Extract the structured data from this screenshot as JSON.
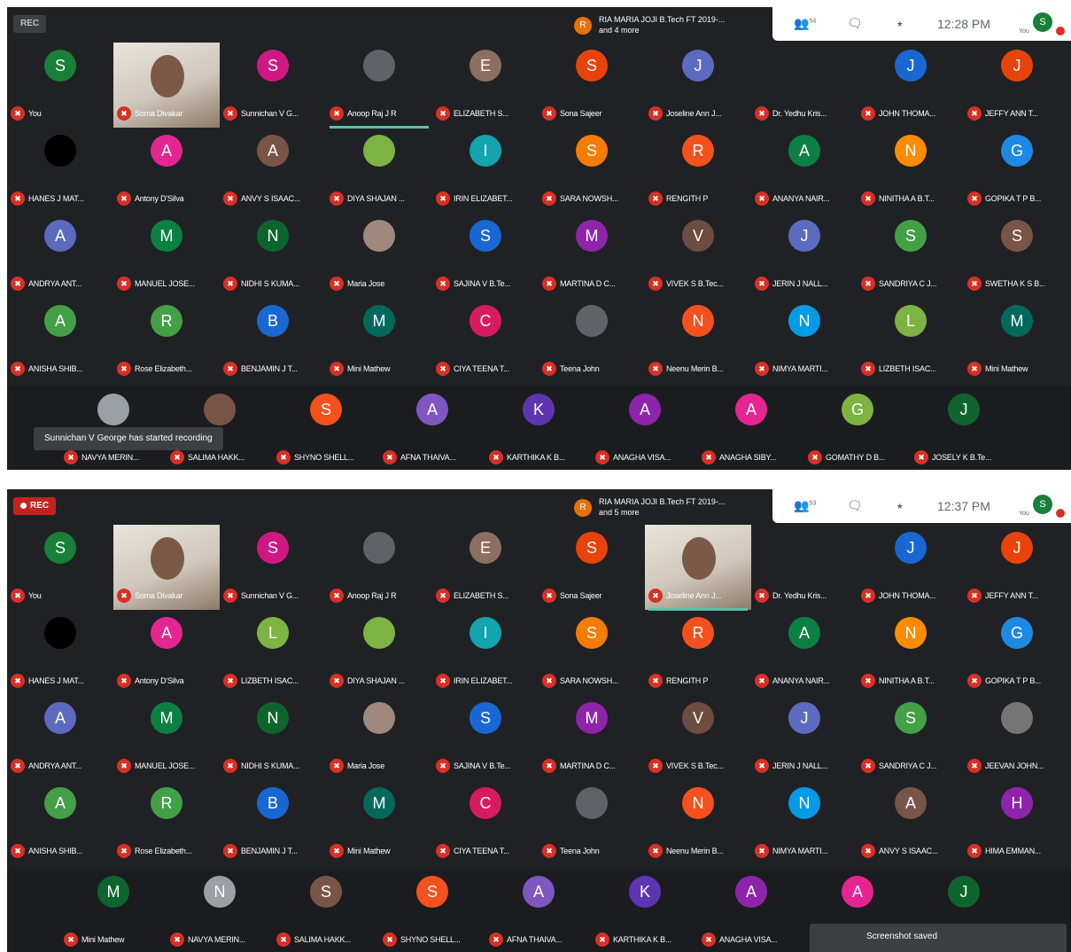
{
  "panels": [
    {
      "rec_label": "REC",
      "recording": false,
      "presenter": {
        "initial": "R",
        "name": "RIA MARIA JOJI B.Tech FT 2019-...",
        "more": "and 4 more"
      },
      "people_count": "54",
      "time": "12:28 PM",
      "self_initial": "S",
      "self_label": "You",
      "toast": "Sunnichan V George has started recording",
      "grid": [
        [
          {
            "initial": "S",
            "name": "You",
            "color": "#188038"
          },
          {
            "name": "Soma Divakar",
            "video": true
          },
          {
            "initial": "S",
            "name": "Sunnichan V G...",
            "color": "#d01884"
          },
          {
            "initial": "",
            "name": "Anoop Raj J R",
            "color": "#5f6368",
            "speaking": true
          },
          {
            "initial": "E",
            "name": "ELIZABETH S...",
            "color": "#8d6e63"
          },
          {
            "initial": "S",
            "name": "Sona Sajeer",
            "color": "#e8430a"
          },
          {
            "initial": "J",
            "name": "Joseline Ann J...",
            "color": "#5c6bc0"
          },
          {
            "initial": "",
            "name": "Dr. Yedhu Kris...",
            "color": "#202124"
          },
          {
            "initial": "J",
            "name": "JOHN THOMA...",
            "color": "#1967d2"
          },
          {
            "initial": "J",
            "name": "JEFFY ANN T...",
            "color": "#e8430a"
          }
        ],
        [
          {
            "initial": "",
            "name": "HANES J MAT...",
            "color": "#000000"
          },
          {
            "initial": "A",
            "name": "Antony D'Silva",
            "color": "#e52592"
          },
          {
            "initial": "A",
            "name": "ANVY S ISAAC...",
            "color": "#795548"
          },
          {
            "initial": "",
            "name": "DIYA SHAJAN ...",
            "color": "#7cb342"
          },
          {
            "initial": "I",
            "name": "IRIN ELIZABET...",
            "color": "#12a4af"
          },
          {
            "initial": "S",
            "name": "SARA NOWSH...",
            "color": "#f57c00"
          },
          {
            "initial": "R",
            "name": "RENGITH P",
            "color": "#f4511e"
          },
          {
            "initial": "A",
            "name": "ANANYA NAIR...",
            "color": "#0b8043"
          },
          {
            "initial": "N",
            "name": "NINITHA A B.T...",
            "color": "#fb8c00"
          },
          {
            "initial": "G",
            "name": "GOPIKA T P B...",
            "color": "#1e88e5"
          }
        ],
        [
          {
            "initial": "A",
            "name": "ANDRYA ANT...",
            "color": "#5c6bc0"
          },
          {
            "initial": "M",
            "name": "MANUEL JOSE...",
            "color": "#0b8043"
          },
          {
            "initial": "N",
            "name": "NIDHI S KUMA...",
            "color": "#0d652d"
          },
          {
            "initial": "",
            "name": "Maria Jose",
            "color": "#a1887f"
          },
          {
            "initial": "S",
            "name": "SAJINA V B.Te...",
            "color": "#1967d2"
          },
          {
            "initial": "M",
            "name": "MARTINA D C...",
            "color": "#8e24aa"
          },
          {
            "initial": "V",
            "name": "VIVEK S B.Tec...",
            "color": "#6d4c41"
          },
          {
            "initial": "J",
            "name": "JERIN J NALL...",
            "color": "#5c6bc0"
          },
          {
            "initial": "S",
            "name": "SANDRIYA C J...",
            "color": "#43a047"
          },
          {
            "initial": "S",
            "name": "SWETHA K S B...",
            "color": "#795548"
          }
        ],
        [
          {
            "initial": "A",
            "name": "ANISHA SHIB...",
            "color": "#43a047"
          },
          {
            "initial": "R",
            "name": "Rose Elizabeth...",
            "color": "#43a047"
          },
          {
            "initial": "B",
            "name": "BENJAMIN J T...",
            "color": "#1967d2"
          },
          {
            "initial": "M",
            "name": "Mini Mathew",
            "color": "#00695c"
          },
          {
            "initial": "C",
            "name": "CIYA TEENA T...",
            "color": "#d81b60"
          },
          {
            "initial": "",
            "name": "Teena John",
            "color": "#5f6368"
          },
          {
            "initial": "N",
            "name": "Neenu Merin B...",
            "color": "#f4511e"
          },
          {
            "initial": "N",
            "name": "NIMYA MARTI...",
            "color": "#039be5"
          },
          {
            "initial": "L",
            "name": "LIZBETH ISAC...",
            "color": "#7cb342"
          },
          {
            "initial": "M",
            "name": "Mini Mathew",
            "color": "#00695c"
          }
        ]
      ],
      "filmstrip": [
        {
          "initial": "",
          "name": "NAVYA MERIN...",
          "color": "#9aa0a6"
        },
        {
          "initial": "",
          "name": "SALIMA HAKK...",
          "color": "#795548"
        },
        {
          "initial": "S",
          "name": "SHYNO SHELL...",
          "color": "#f4511e"
        },
        {
          "initial": "A",
          "name": "AFNA THAIVA...",
          "color": "#7e57c2"
        },
        {
          "initial": "K",
          "name": "KARTHIKA K B...",
          "color": "#5e35b1"
        },
        {
          "initial": "A",
          "name": "ANAGHA VISA...",
          "color": "#8e24aa"
        },
        {
          "initial": "A",
          "name": "ANAGHA SIBY...",
          "color": "#e52592"
        },
        {
          "initial": "G",
          "name": "GOMATHY D B...",
          "color": "#7cb342"
        },
        {
          "initial": "J",
          "name": "JOSELY K B.Te...",
          "color": "#0d652d"
        }
      ]
    },
    {
      "rec_label": "REC",
      "recording": true,
      "presenter": {
        "initial": "R",
        "name": "RIA MARIA JOJI B.Tech FT 2019-...",
        "more": "and 5 more"
      },
      "people_count": "53",
      "time": "12:37 PM",
      "self_initial": "S",
      "self_label": "You",
      "notice": "Screenshot saved",
      "grid": [
        [
          {
            "initial": "S",
            "name": "You",
            "color": "#188038"
          },
          {
            "name": "Soma Divakar",
            "video": true
          },
          {
            "initial": "S",
            "name": "Sunnichan V G...",
            "color": "#d01884"
          },
          {
            "initial": "",
            "name": "Anoop Raj J R",
            "color": "#5f6368"
          },
          {
            "initial": "E",
            "name": "ELIZABETH S...",
            "color": "#8d6e63"
          },
          {
            "initial": "S",
            "name": "Sona Sajeer",
            "color": "#e8430a"
          },
          {
            "name": "Joseline Ann J...",
            "video": true,
            "speaking": true
          },
          {
            "initial": "",
            "name": "Dr. Yedhu Kris...",
            "color": "#202124"
          },
          {
            "initial": "J",
            "name": "JOHN THOMA...",
            "color": "#1967d2"
          },
          {
            "initial": "J",
            "name": "JEFFY ANN T...",
            "color": "#e8430a"
          }
        ],
        [
          {
            "initial": "",
            "name": "HANES J MAT...",
            "color": "#000000"
          },
          {
            "initial": "A",
            "name": "Antony D'Silva",
            "color": "#e52592"
          },
          {
            "initial": "L",
            "name": "LIZBETH ISAC...",
            "color": "#7cb342"
          },
          {
            "initial": "",
            "name": "DIYA SHAJAN ...",
            "color": "#7cb342"
          },
          {
            "initial": "I",
            "name": "IRIN ELIZABET...",
            "color": "#12a4af"
          },
          {
            "initial": "S",
            "name": "SARA NOWSH...",
            "color": "#f57c00"
          },
          {
            "initial": "R",
            "name": "RENGITH P",
            "color": "#f4511e"
          },
          {
            "initial": "A",
            "name": "ANANYA NAIR...",
            "color": "#0b8043"
          },
          {
            "initial": "N",
            "name": "NINITHA A B.T...",
            "color": "#fb8c00"
          },
          {
            "initial": "G",
            "name": "GOPIKA T P B...",
            "color": "#1e88e5"
          }
        ],
        [
          {
            "initial": "A",
            "name": "ANDRYA ANT...",
            "color": "#5c6bc0"
          },
          {
            "initial": "M",
            "name": "MANUEL JOSE...",
            "color": "#0b8043"
          },
          {
            "initial": "N",
            "name": "NIDHI S KUMA...",
            "color": "#0d652d"
          },
          {
            "initial": "",
            "name": "Maria Jose",
            "color": "#a1887f"
          },
          {
            "initial": "S",
            "name": "SAJINA V B.Te...",
            "color": "#1967d2"
          },
          {
            "initial": "M",
            "name": "MARTINA D C...",
            "color": "#8e24aa"
          },
          {
            "initial": "V",
            "name": "VIVEK S B.Tec...",
            "color": "#6d4c41"
          },
          {
            "initial": "J",
            "name": "JERIN J NALL...",
            "color": "#5c6bc0"
          },
          {
            "initial": "S",
            "name": "SANDRIYA C J...",
            "color": "#43a047"
          },
          {
            "initial": "",
            "name": "JEEVAN JOHN...",
            "color": "#757575"
          }
        ],
        [
          {
            "initial": "A",
            "name": "ANISHA SHIB...",
            "color": "#43a047"
          },
          {
            "initial": "R",
            "name": "Rose Elizabeth...",
            "color": "#43a047"
          },
          {
            "initial": "B",
            "name": "BENJAMIN J T...",
            "color": "#1967d2"
          },
          {
            "initial": "M",
            "name": "Mini Mathew",
            "color": "#00695c"
          },
          {
            "initial": "C",
            "name": "CIYA TEENA T...",
            "color": "#d81b60"
          },
          {
            "initial": "",
            "name": "Teena John",
            "color": "#5f6368"
          },
          {
            "initial": "N",
            "name": "Neenu Merin B...",
            "color": "#f4511e"
          },
          {
            "initial": "N",
            "name": "NIMYA MARTI...",
            "color": "#039be5"
          },
          {
            "initial": "A",
            "name": "ANVY S ISAAC...",
            "color": "#795548"
          },
          {
            "initial": "H",
            "name": "HIMA EMMAN...",
            "color": "#8e24aa"
          }
        ]
      ],
      "filmstrip": [
        {
          "initial": "M",
          "name": "Mini Mathew",
          "color": "#0d652d"
        },
        {
          "initial": "N",
          "name": "NAVYA MERIN...",
          "color": "#9aa0a6"
        },
        {
          "initial": "S",
          "name": "SALIMA HAKK...",
          "color": "#795548"
        },
        {
          "initial": "S",
          "name": "SHYNO SHELL...",
          "color": "#f4511e"
        },
        {
          "initial": "A",
          "name": "AFNA THAIVA...",
          "color": "#7e57c2"
        },
        {
          "initial": "K",
          "name": "KARTHIKA K B...",
          "color": "#5e35b1"
        },
        {
          "initial": "A",
          "name": "ANAGHA VISA...",
          "color": "#8e24aa"
        },
        {
          "initial": "A",
          "name": "",
          "color": "#e52592"
        },
        {
          "initial": "J",
          "name": "",
          "color": "#0d652d"
        }
      ]
    }
  ]
}
